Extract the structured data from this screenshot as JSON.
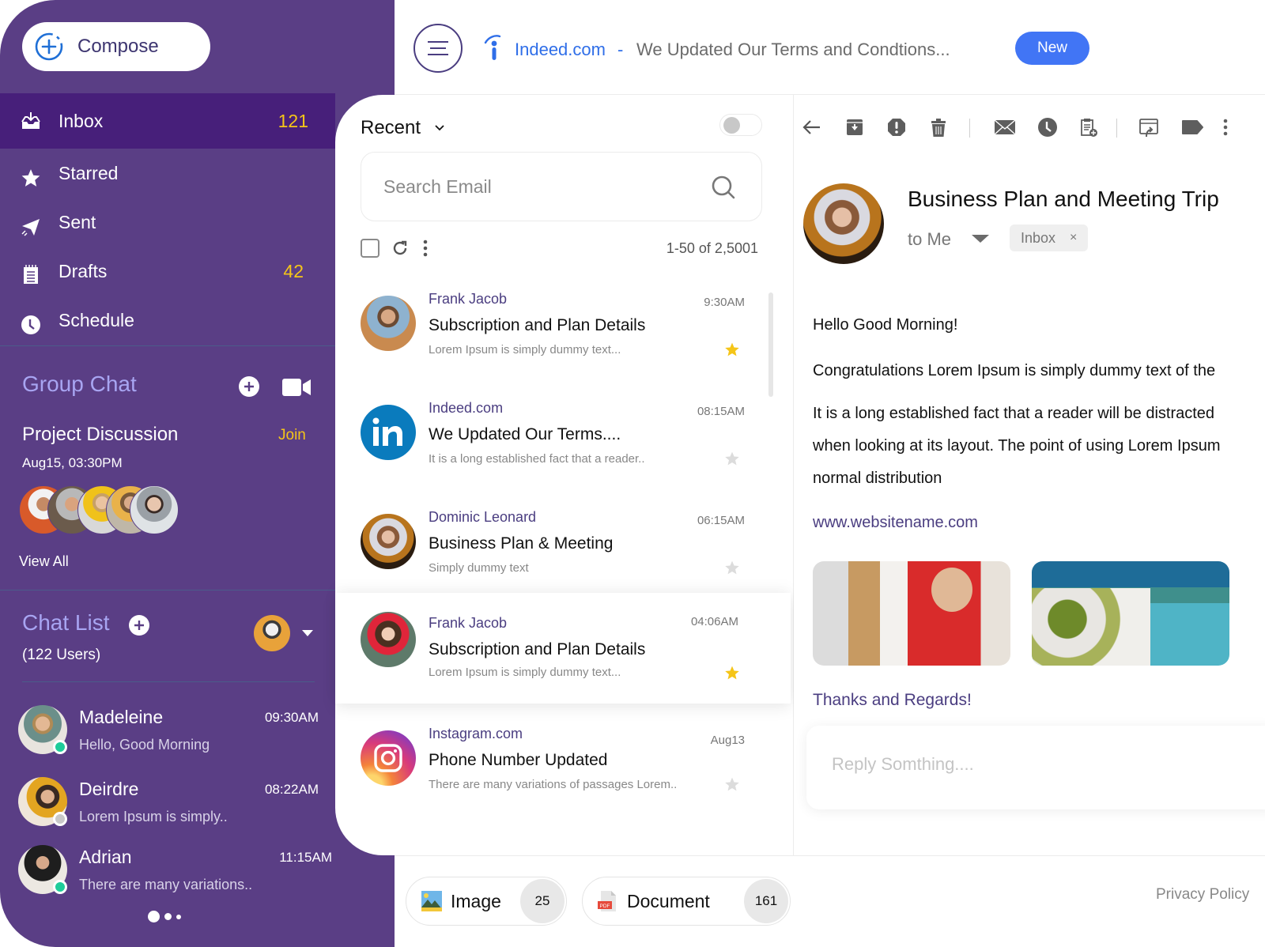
{
  "compose": {
    "label": "Compose"
  },
  "nav": [
    {
      "label": "Inbox",
      "count": "121",
      "icon": "inbox-icon",
      "active": true
    },
    {
      "label": "Starred",
      "count": "",
      "icon": "star-icon",
      "active": false
    },
    {
      "label": "Sent",
      "count": "",
      "icon": "send-icon",
      "active": false
    },
    {
      "label": "Drafts",
      "count": "42",
      "icon": "drafts-icon",
      "active": false
    },
    {
      "label": "Schedule",
      "count": "",
      "icon": "clock-icon",
      "active": false
    }
  ],
  "group_chat": {
    "title": "Group Chat",
    "meeting_title": "Project Discussion",
    "join_label": "Join",
    "datetime": "Aug15, 03:30PM",
    "member_count_shown": 5,
    "view_all_label": "View All"
  },
  "chat_list": {
    "title": "Chat List",
    "users_label": "(122 Users)",
    "chats": [
      {
        "name": "Madeleine",
        "time": "09:30AM",
        "message": "Hello, Good Morning",
        "status": "online"
      },
      {
        "name": "Deirdre",
        "time": "08:22AM",
        "message": "Lorem Ipsum is simply..",
        "status": "offline"
      },
      {
        "name": "Adrian",
        "time": "11:15AM",
        "message": "There are many variations..",
        "status": "online"
      }
    ],
    "pager": {
      "pages": 3,
      "current": 1
    }
  },
  "topbar": {
    "sender": "Indeed.com",
    "separator": "-",
    "subject": "We Updated Our Terms and Condtions...",
    "new_label": "New"
  },
  "list": {
    "filter_label": "Recent",
    "toggle_on": false,
    "search_placeholder": "Search Email",
    "range_label": "1-50 of 2,5001",
    "emails": [
      {
        "from": "Frank Jacob",
        "time": "9:30AM",
        "subject": "Subscription and Plan Details",
        "preview": "Lorem Ipsum is simply dummy text...",
        "starred": true,
        "selected": false,
        "avatar": "photo"
      },
      {
        "from": "Indeed.com",
        "time": "08:15AM",
        "subject": "We Updated Our Terms....",
        "preview": "It is a long established fact that a reader..",
        "starred": false,
        "selected": false,
        "avatar": "linkedin-logo"
      },
      {
        "from": "Dominic Leonard",
        "time": "06:15AM",
        "subject": "Business Plan & Meeting",
        "preview": "Simply dummy text",
        "starred": false,
        "selected": false,
        "avatar": "photo"
      },
      {
        "from": "Frank Jacob",
        "time": "04:06AM",
        "subject": "Subscription and Plan Details",
        "preview": "Lorem Ipsum is simply dummy text...",
        "starred": true,
        "selected": true,
        "avatar": "photo"
      },
      {
        "from": "Instagram.com",
        "time": "Aug13",
        "subject": "Phone Number Updated",
        "preview": "There are many variations of passages Lorem..",
        "starred": false,
        "selected": false,
        "avatar": "instagram-logo"
      }
    ]
  },
  "reader": {
    "toolbar": [
      "back-icon",
      "archive-icon",
      "report-spam-icon",
      "delete-icon",
      "mark-unread-icon",
      "snooze-icon",
      "add-to-tasks-icon",
      "move-to-icon",
      "label-icon",
      "more-icon"
    ],
    "subject": "Business Plan and Meeting Trip",
    "to_label": "to Me",
    "tag": "Inbox",
    "tag_close": "×",
    "greeting": "Hello Good Morning!",
    "paragraph1": "Congratulations Lorem Ipsum is simply dummy text of the",
    "paragraph2_lines": [
      "It is a long established fact that a reader will be distracted",
      "when looking at its layout. The point of using Lorem Ipsum",
      "normal distribution"
    ],
    "link": "www.websitename.com",
    "attachments": [
      "office-photo",
      "resort-pool-photo"
    ],
    "signoff": "Thanks and Regards!",
    "reply_placeholder": "Reply Somthing...."
  },
  "bottombar": {
    "chips": [
      {
        "label": "Image",
        "count": "25",
        "icon": "image-icon"
      },
      {
        "label": "Document",
        "count": "161",
        "icon": "pdf-icon"
      }
    ],
    "privacy_label": "Privacy  Policy"
  },
  "colors": {
    "sidebar": "#5a3e85",
    "sidebar_active": "#471f7a",
    "accent_yellow": "#f5c518",
    "accent_lavender": "#a8a5f2",
    "brand_purple": "#4a3d80",
    "new_button": "#4175f5",
    "online": "#1fcc9a",
    "offline": "#c8c8c8"
  }
}
